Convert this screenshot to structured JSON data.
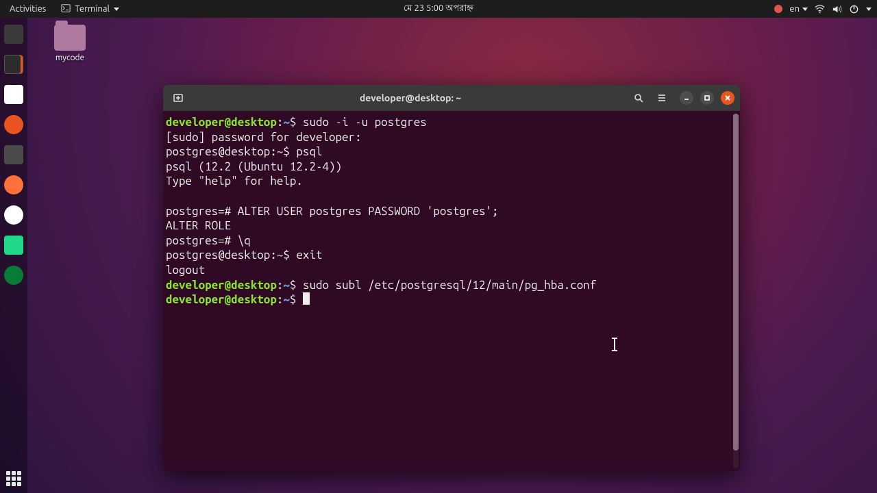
{
  "topbar": {
    "activities": "Activities",
    "appmenu": "Terminal",
    "clock": "মে 23  5:00 অপরাহ্ন",
    "lang": "en"
  },
  "desktop": {
    "folder_label": "mycode"
  },
  "dock": {
    "items": [
      "files",
      "terminal",
      "gedit",
      "ubuntu",
      "sublime",
      "firefox",
      "chrome",
      "pycharm",
      "jetbr"
    ]
  },
  "window": {
    "title": "developer@desktop: ~",
    "newtab_tooltip": "New Tab",
    "search_tooltip": "Search",
    "menu_tooltip": "Menu"
  },
  "terminal": {
    "lines": [
      {
        "type": "prompt_user",
        "user": "developer@desktop",
        "path": "~",
        "cmd": "sudo -i -u postgres"
      },
      {
        "type": "plain",
        "text": "[sudo] password for developer: "
      },
      {
        "type": "prompt_plain",
        "prefix": "postgres@desktop:~$",
        "cmd": "psql"
      },
      {
        "type": "plain",
        "text": "psql (12.2 (Ubuntu 12.2-4))"
      },
      {
        "type": "plain",
        "text": "Type \"help\" for help."
      },
      {
        "type": "blank"
      },
      {
        "type": "prompt_plain",
        "prefix": "postgres=#",
        "cmd": "ALTER USER postgres PASSWORD 'postgres';"
      },
      {
        "type": "plain",
        "text": "ALTER ROLE"
      },
      {
        "type": "prompt_plain",
        "prefix": "postgres=#",
        "cmd": "\\q"
      },
      {
        "type": "prompt_plain",
        "prefix": "postgres@desktop:~$",
        "cmd": "exit"
      },
      {
        "type": "plain",
        "text": "logout"
      },
      {
        "type": "prompt_user",
        "user": "developer@desktop",
        "path": "~",
        "cmd": "sudo subl /etc/postgresql/12/main/pg_hba.conf"
      },
      {
        "type": "prompt_user",
        "user": "developer@desktop",
        "path": "~",
        "cmd": "",
        "cursor": true
      }
    ]
  }
}
